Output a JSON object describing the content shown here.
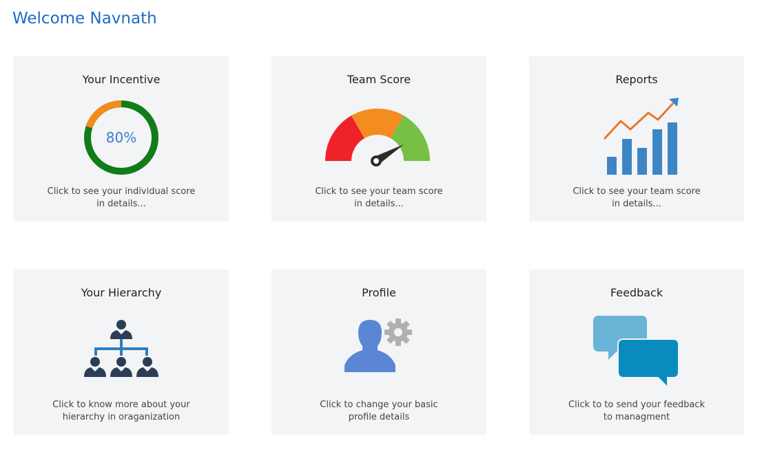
{
  "welcome": "Welcome Navnath",
  "cards": [
    {
      "title": "Your Incentive",
      "line1": "Click to see your individual score",
      "line2": "in details...",
      "icon": "donut-progress-icon",
      "progress_percent": 80,
      "progress_label": "80%",
      "ring_color": "#127c1a",
      "arc_color": "#f28c1c"
    },
    {
      "title": "Team Score",
      "line1": "Click to see your team score",
      "line2": "in details...",
      "icon": "speedometer-gauge-icon"
    },
    {
      "title": "Reports",
      "line1": "Click to see your team score",
      "line2": "in details...",
      "icon": "bar-chart-trend-icon"
    },
    {
      "title": "Your Hierarchy",
      "line1": "Click to know more about your",
      "line2": "hierarchy in oraganization",
      "icon": "org-chart-icon"
    },
    {
      "title": "Profile",
      "line1": "Click to change your basic",
      "line2": "profile details",
      "icon": "user-settings-icon"
    },
    {
      "title": "Feedback",
      "line1": "Click to to send your feedback",
      "line2": "to managment",
      "icon": "chat-bubbles-icon"
    }
  ],
  "colors": {
    "welcome": "#1e6bc6",
    "card_bg": "#f3f4f6",
    "gauge_red": "#ee2228",
    "gauge_orange": "#f38d1f",
    "gauge_green": "#78c043",
    "report_bars": "#3d86c6",
    "report_line": "#e8772e",
    "hierarchy_people": "#2c3e55",
    "hierarchy_lines": "#2f7dc0",
    "profile_person": "#5b86d6",
    "profile_gear": "#b0b0b0",
    "bubble_light": "#69b4d6",
    "bubble_dark": "#0a8bc0"
  }
}
